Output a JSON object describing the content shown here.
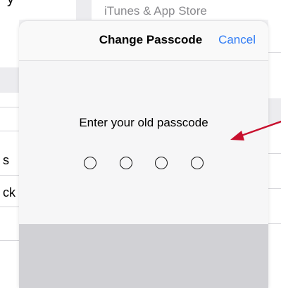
{
  "background": {
    "top_title": "iTunes & App Store",
    "top_partial_text": "y",
    "left_partial_items": [
      "s",
      "ck"
    ]
  },
  "modal": {
    "title": "Change Passcode",
    "cancel_label": "Cancel",
    "prompt": "Enter your old passcode",
    "passcode_length": 4,
    "entered_digits": 0
  },
  "annotation": {
    "color": "#c8102e",
    "icon": "arrow-icon"
  },
  "colors": {
    "accent": "#2f7bf5",
    "footer": "#d1d1d5"
  }
}
